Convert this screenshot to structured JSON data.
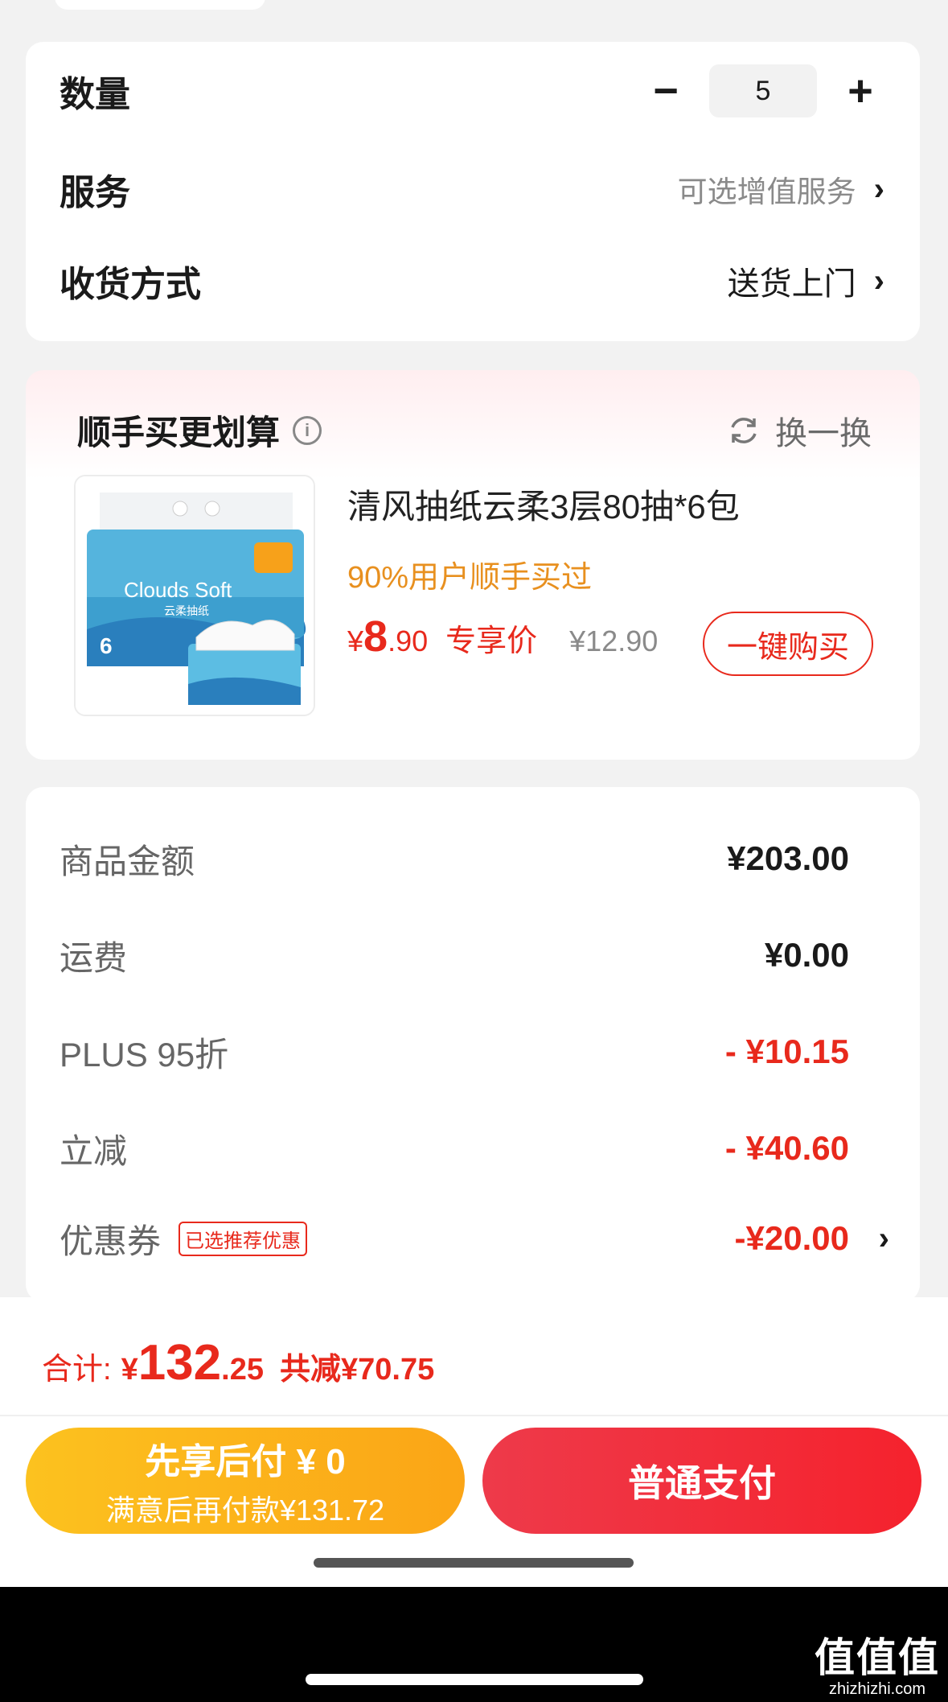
{
  "options": {
    "quantity_label": "数量",
    "quantity_minus": "−",
    "quantity_value": "5",
    "quantity_plus": "+",
    "service_label": "服务",
    "service_value": "可选增值服务",
    "delivery_label": "收货方式",
    "delivery_value": "送货上门",
    "chevron": "›"
  },
  "recommend": {
    "title": "顺手买更划算",
    "info_glyph": "i",
    "refresh_label": "换一换",
    "product": {
      "name": "清风抽纸云柔3层80抽*6包",
      "tag": "90%用户顺手买过",
      "price_yen": "¥",
      "price_int": "8",
      "price_dec": ".90",
      "price_label": "专享价",
      "original_price": "¥12.90",
      "buy_label": "一键购买",
      "image_brand": "Clouds Soft",
      "image_brand_cn": "云柔抽纸",
      "image_pack_count": "6"
    }
  },
  "summary": {
    "rows": [
      {
        "label": "商品金额",
        "value": "¥203.00"
      },
      {
        "label": "运费",
        "value": "¥0.00"
      },
      {
        "label": "PLUS 95折",
        "value": "- ¥10.15"
      },
      {
        "label": "立减",
        "value": "- ¥40.60"
      },
      {
        "label": "优惠券",
        "value": "-¥20.00",
        "tag": "已选推荐优惠"
      }
    ]
  },
  "footer": {
    "total_label": "合计:",
    "total_yen": "¥",
    "total_int": "132",
    "total_dec": ".25",
    "total_saved": "共减¥70.75",
    "pay_later_line1": "先享后付 ¥ 0",
    "pay_later_line2": "满意后再付款¥131.72",
    "pay_normal": "普通支付"
  },
  "watermark": {
    "line1": "值值值",
    "line2": "zhizhizhi.com"
  },
  "colors": {
    "accent_red": "#e8291c",
    "tag_orange": "#e8901f",
    "pay_later": "#fcc21f",
    "pay_normal": "#f5222d"
  }
}
